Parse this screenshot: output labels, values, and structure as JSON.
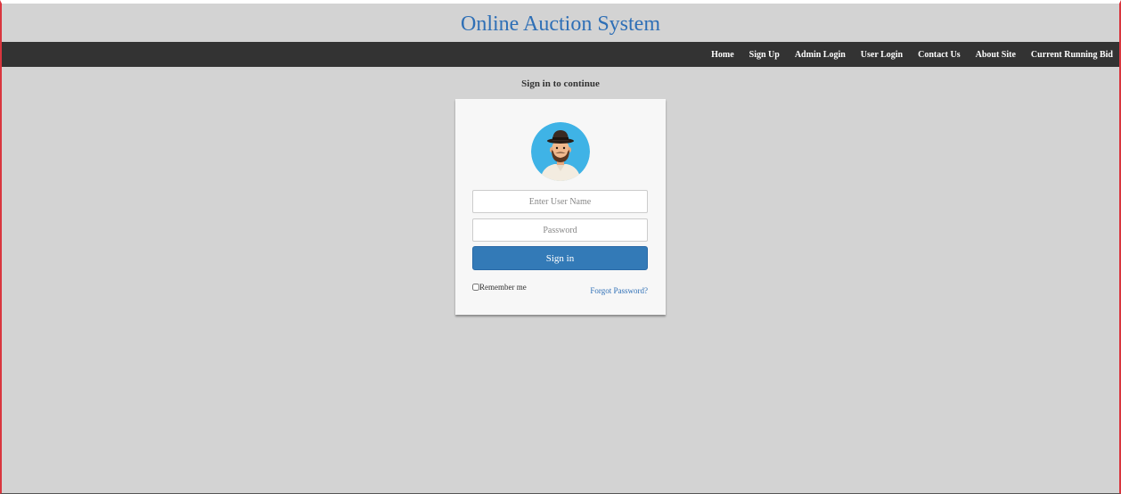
{
  "header": {
    "title": "Online Auction System"
  },
  "nav": {
    "items": [
      {
        "label": "Home"
      },
      {
        "label": "Sign Up"
      },
      {
        "label": "Admin Login"
      },
      {
        "label": "User Login"
      },
      {
        "label": "Contact Us"
      },
      {
        "label": "About Site"
      },
      {
        "label": "Current Running Bid"
      }
    ]
  },
  "login": {
    "heading": "Sign in to continue",
    "avatar_icon": "user-avatar-icon",
    "username_placeholder": "Enter User Name",
    "username_value": "",
    "password_placeholder": "Password",
    "password_value": "",
    "signin_label": "Sign in",
    "remember_label": "Remember me",
    "remember_checked": false,
    "forgot_label": "Forgot Password?"
  },
  "colors": {
    "background": "#d3d3d3",
    "navbar": "#333333",
    "title": "#2e6fb6",
    "primary_button": "#337ab7",
    "frame_border": "#d9363e"
  }
}
